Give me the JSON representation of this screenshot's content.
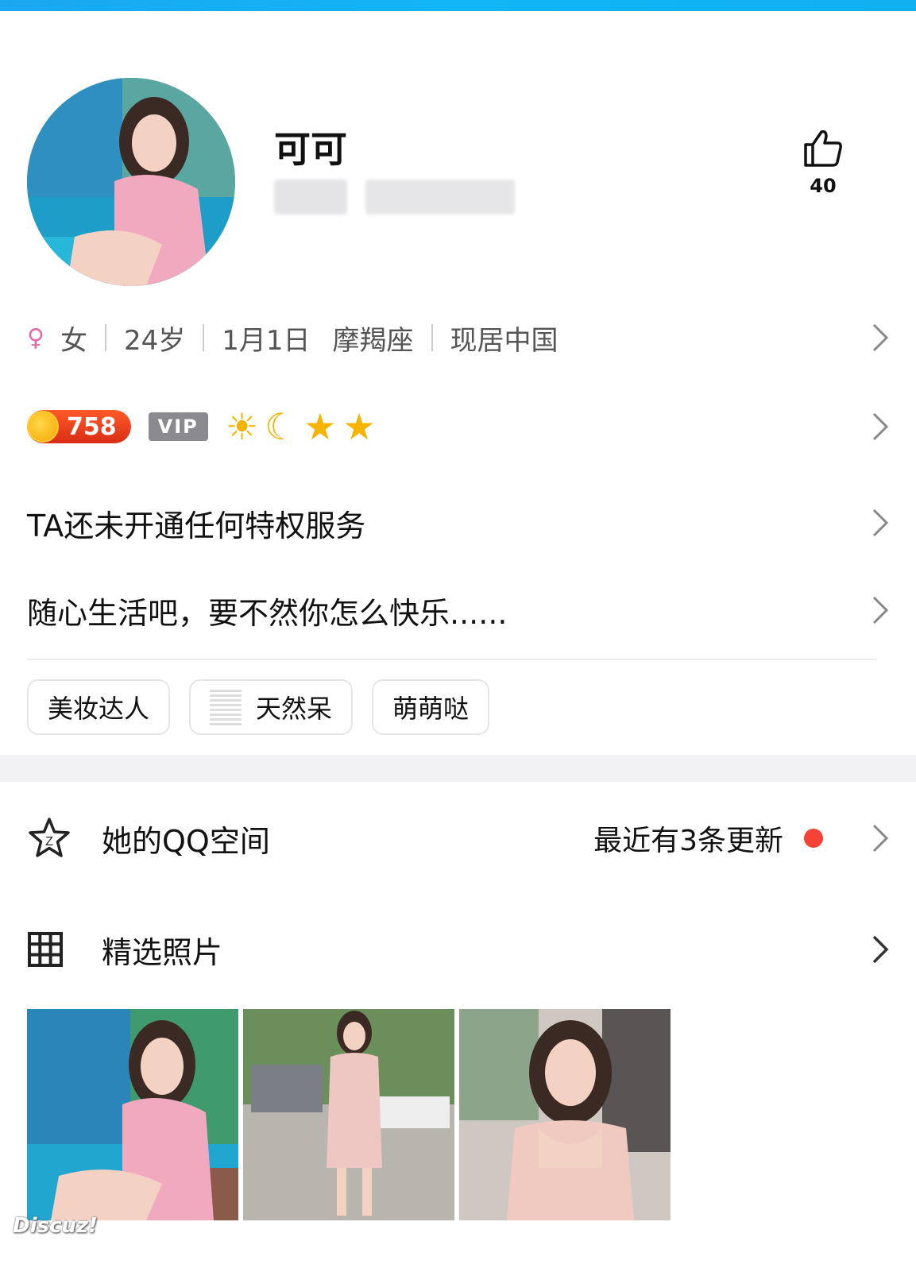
{
  "profile": {
    "nickname": "可可",
    "likes": "40"
  },
  "info": {
    "gender": "女",
    "age": "24岁",
    "birthday": "1月1日",
    "constellation": "摩羯座",
    "location": "现居中国"
  },
  "badges": {
    "coin_value": "758",
    "vip_label": "VIP",
    "level_icons": [
      "sun-icon",
      "moon-icon",
      "star-icon",
      "star-icon"
    ]
  },
  "privilege_text": "TA还未开通任何特权服务",
  "signature": "随心生活吧，要不然你怎么快乐......",
  "tags": [
    "美妆达人",
    "天然呆",
    "萌萌哒"
  ],
  "qzone": {
    "label": "她的QQ空间",
    "update_text": "最近有3条更新"
  },
  "photos": {
    "label": "精选照片"
  },
  "watermark": "Discuz!",
  "colors": {
    "top_bar": "#12b6f5",
    "red_dot": "#f44336",
    "coin": "#d92d14",
    "vip": "#8a8a8f"
  }
}
